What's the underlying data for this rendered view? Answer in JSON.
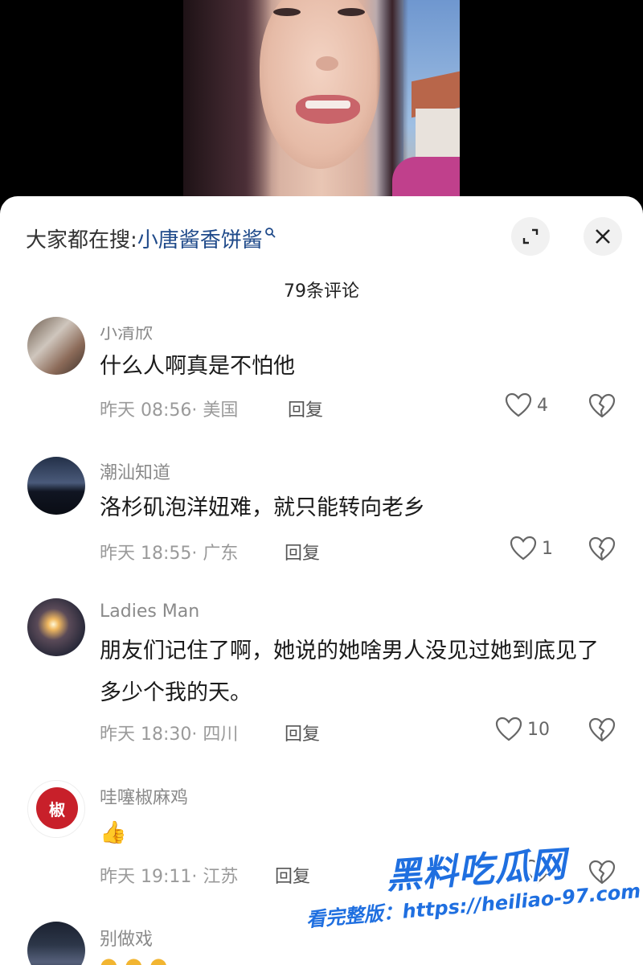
{
  "header": {
    "search_prefix": "大家都在搜:",
    "search_term": "小唐酱香饼酱"
  },
  "comment_count": "79条评论",
  "comments": [
    {
      "name": "小清欣",
      "text": "什么人啊真是不怕他",
      "meta": "昨天 08:56· 美国",
      "reply": "回复",
      "likes": "4"
    },
    {
      "name": "潮汕知道",
      "text": "洛杉矶泡洋妞难，就只能转向老乡",
      "meta": "昨天 18:55· 广东",
      "reply": "回复",
      "likes": "1"
    },
    {
      "name": "Ladies Man",
      "text": "朋友们记住了啊，她说的她啥男人没见过她到底见了多少个我的天。",
      "meta": "昨天 18:30· 四川",
      "reply": "回复",
      "likes": "10"
    },
    {
      "name": "哇噻椒麻鸡",
      "text": "👍",
      "meta": "昨天 19:11· 江苏",
      "reply": "回复",
      "likes": "",
      "avatar_text": "椒"
    },
    {
      "name": "别做戏",
      "text": "",
      "meta": "",
      "reply": "",
      "likes": ""
    }
  ],
  "watermark": {
    "title": "黑料吃瓜网",
    "subtitle": "看完整版：https://heiliao-97.com"
  },
  "colors": {
    "search_term": "#1f4a8a",
    "watermark": "#1f6fe0"
  }
}
